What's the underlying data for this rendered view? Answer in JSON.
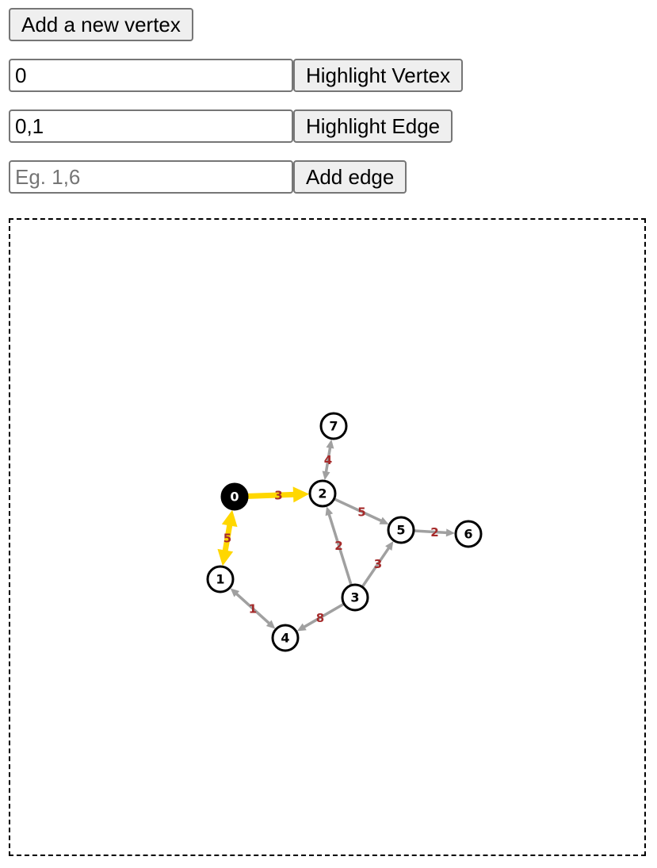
{
  "controls": {
    "add_vertex_label": "Add a new vertex",
    "vertex_input_value": "0",
    "highlight_vertex_label": "Highlight Vertex",
    "edge_input_value": "0,1",
    "highlight_edge_label": "Highlight Edge",
    "add_edge_placeholder": "Eg. 1,6",
    "add_edge_label": "Add edge"
  },
  "graph": {
    "colors": {
      "edge": "#a0a0a0",
      "highlight": "#ffd700",
      "edge_label": "#a52a2a",
      "node_stroke": "#000000",
      "node_fill": "#ffffff",
      "highlight_node_fill": "#000000"
    },
    "highlighted_vertex": "0",
    "highlighted_edges": [
      "0-2",
      "0-1"
    ],
    "nodes": [
      {
        "id": "0"
      },
      {
        "id": "1"
      },
      {
        "id": "2"
      },
      {
        "id": "3"
      },
      {
        "id": "4"
      },
      {
        "id": "5"
      },
      {
        "id": "6"
      },
      {
        "id": "7"
      }
    ],
    "edges": [
      {
        "id": "0-2",
        "from": "0",
        "to": "2",
        "weight": "3",
        "bidirectional": false
      },
      {
        "id": "0-1",
        "from": "0",
        "to": "1",
        "weight": "5",
        "bidirectional": true
      },
      {
        "id": "2-7",
        "from": "2",
        "to": "7",
        "weight": "4",
        "bidirectional": true
      },
      {
        "id": "2-5",
        "from": "2",
        "to": "5",
        "weight": "5",
        "bidirectional": false
      },
      {
        "id": "3-2",
        "from": "3",
        "to": "2",
        "weight": "2",
        "bidirectional": false
      },
      {
        "id": "3-5",
        "from": "3",
        "to": "5",
        "weight": "3",
        "bidirectional": false
      },
      {
        "id": "5-6",
        "from": "5",
        "to": "6",
        "weight": "2",
        "bidirectional": false
      },
      {
        "id": "3-4",
        "from": "3",
        "to": "4",
        "weight": "8",
        "bidirectional": false
      },
      {
        "id": "1-4",
        "from": "1",
        "to": "4",
        "weight": "1",
        "bidirectional": true
      }
    ]
  }
}
